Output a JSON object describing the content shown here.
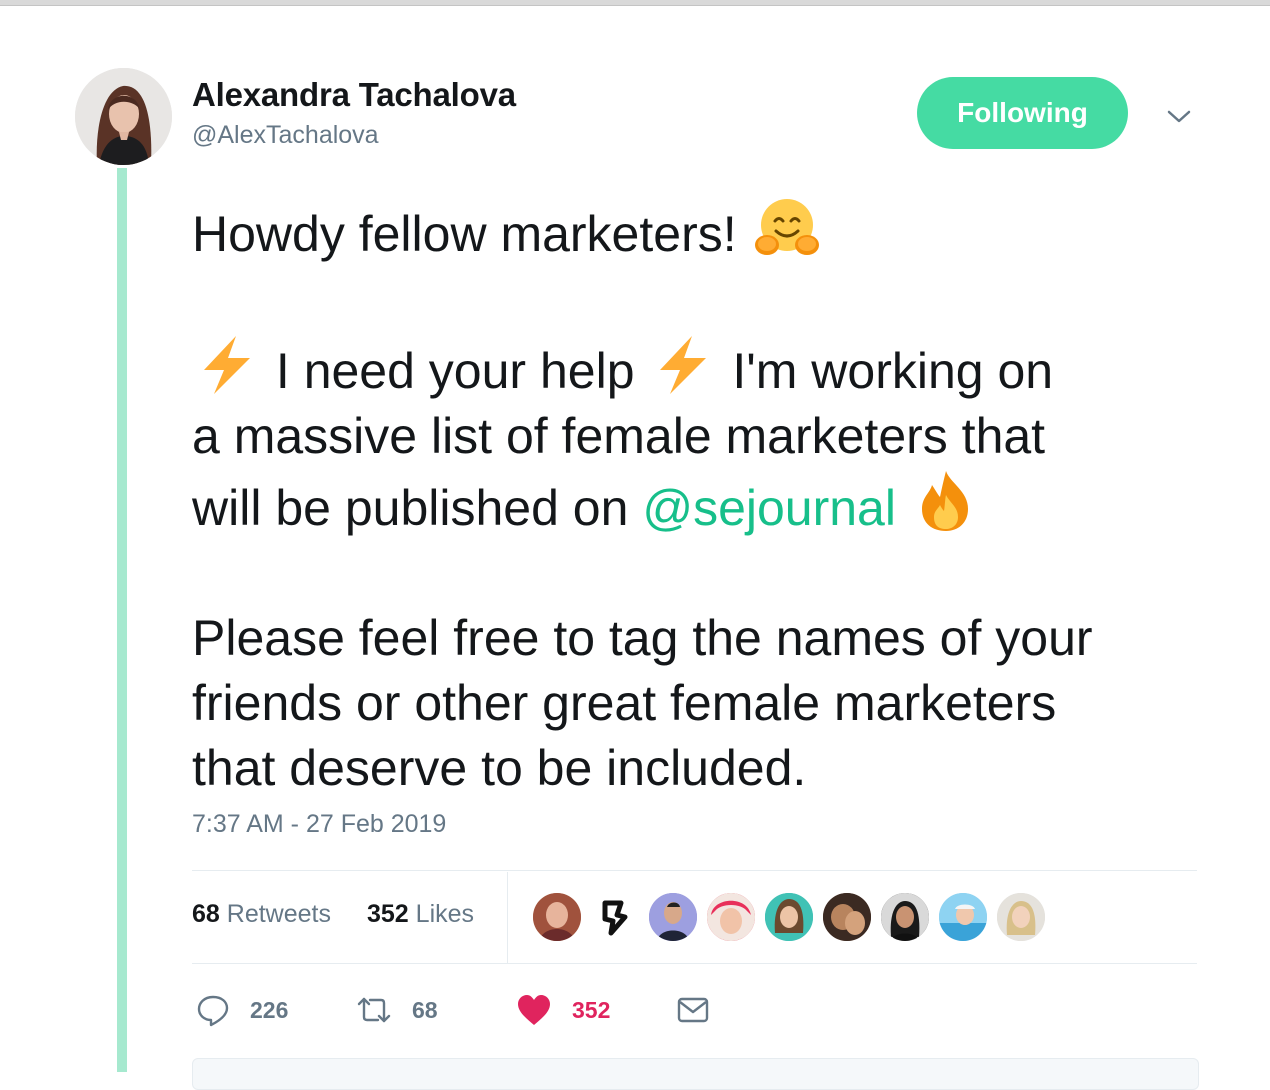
{
  "author": {
    "name": "Alexandra Tachalova",
    "handle": "@AlexTachalova"
  },
  "follow_button": {
    "label": "Following",
    "color": "#45dba3"
  },
  "tweet": {
    "line1": "Howdy fellow marketers!",
    "line2_a": "I need your help",
    "line2_b": "I'm working on",
    "line3": "a massive list of female marketers that",
    "line4_a": "will be published on",
    "mention": "@sejournal",
    "para3_line1": "Please feel free to tag the names of your",
    "para3_line2": "friends or other great female marketers",
    "para3_line3": "that deserve to be included.",
    "emojis": [
      "hugging-face-icon",
      "lightning-icon",
      "lightning-icon",
      "fire-icon"
    ]
  },
  "timestamp": "7:37 AM - 27 Feb 2019",
  "stats": {
    "retweets_count": "68",
    "retweets_label": "Retweets",
    "likes_count": "352",
    "likes_label": "Likes"
  },
  "actions": {
    "reply_count": "226",
    "retweet_count": "68",
    "like_count": "352"
  },
  "colors": {
    "accent": "#45dba3",
    "mention": "#17bf8a",
    "thread_line": "#a6e9cf",
    "like": "#e0245e",
    "muted": "#657786"
  }
}
